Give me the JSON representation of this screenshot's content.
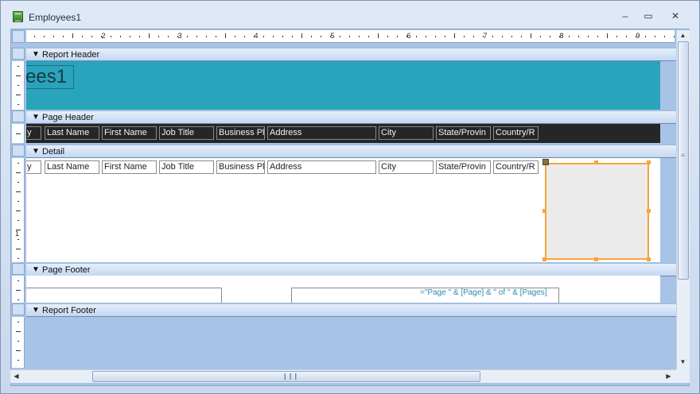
{
  "window": {
    "title": "Employees1",
    "minimize": "–",
    "maximize": "▭",
    "close": "✕"
  },
  "ruler": {
    "numbers": [
      "2",
      "3",
      "4",
      "5",
      "6",
      "7",
      "8",
      "9"
    ],
    "vertical_number": "1"
  },
  "sections": {
    "report_header": "Report Header",
    "page_header": "Page Header",
    "detail": "Detail",
    "page_footer": "Page Footer",
    "report_footer": "Report Footer"
  },
  "report_title": "ees1",
  "page_header_fields": [
    "y",
    "Last Name",
    "First Name",
    "Job Title",
    "Business Pl",
    "Address",
    "City",
    "State/Provin",
    "Country/R"
  ],
  "detail_fields": [
    "y",
    "Last Name",
    "First Name",
    "Job Title",
    "Business Pl",
    "Address",
    "City",
    "State/Provin",
    "Country/R"
  ],
  "page_footer": {
    "page_expression": "=\"Page \" & [Page] & \" of \" & [Pages]"
  },
  "icons": {
    "app": "access-report-icon",
    "section_arrow": "section-collapse-icon"
  },
  "colors": {
    "report_header_bg": "#2aa3bc",
    "page_header_bg": "#262626",
    "selection": "#f4a63a",
    "expression_text": "#2a8bb0"
  }
}
